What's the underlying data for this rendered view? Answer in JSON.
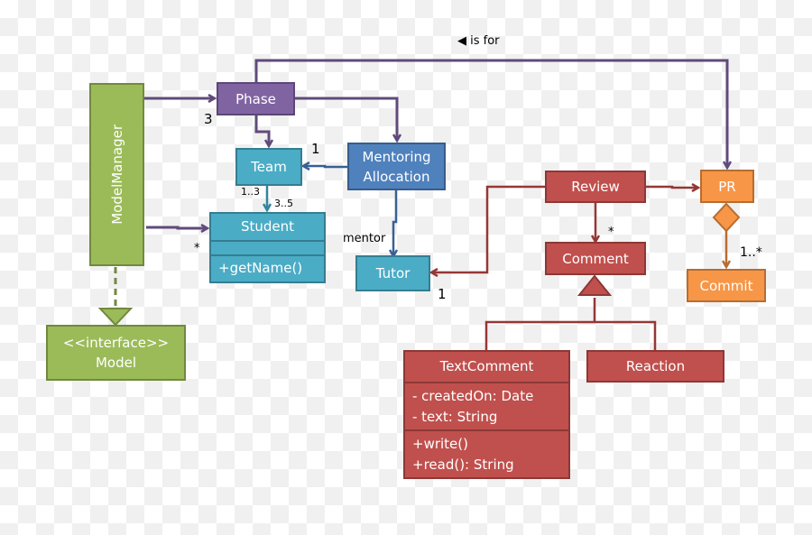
{
  "diagram": {
    "type": "UML class diagram",
    "classes": {
      "model_manager": "ModelManager",
      "model": {
        "stereotype": "<<interface>>",
        "name": "Model"
      },
      "phase": "Phase",
      "team": "Team",
      "mentoring_allocation": {
        "line1": "Mentoring",
        "line2": "Allocation"
      },
      "student": {
        "name": "Student",
        "attributes": "",
        "methods": "+getName()"
      },
      "tutor": "Tutor",
      "review": "Review",
      "pr": "PR",
      "comment": "Comment",
      "commit": "Commit",
      "text_comment": {
        "name": "TextComment",
        "attributes": [
          "- createdOn: Date",
          "- text: String"
        ],
        "methods": [
          "+write()",
          "+read(): String"
        ]
      },
      "reaction": "Reaction"
    },
    "labels": {
      "is_for": "◀ is for",
      "phase_mult": "3",
      "team_mult_1": "1",
      "team_student_1_3": "1..3",
      "team_student_3_5": "3..5",
      "student_mult": "*",
      "mentor": "mentor",
      "tutor_mult": "1",
      "comment_mult": "*",
      "commit_mult": "1..*"
    },
    "colors": {
      "green": "#9bbb59",
      "purple": "#8064a2",
      "teal": "#4bacc6",
      "blue": "#4f81bd",
      "red": "#c0504d",
      "orange": "#f79646"
    }
  }
}
